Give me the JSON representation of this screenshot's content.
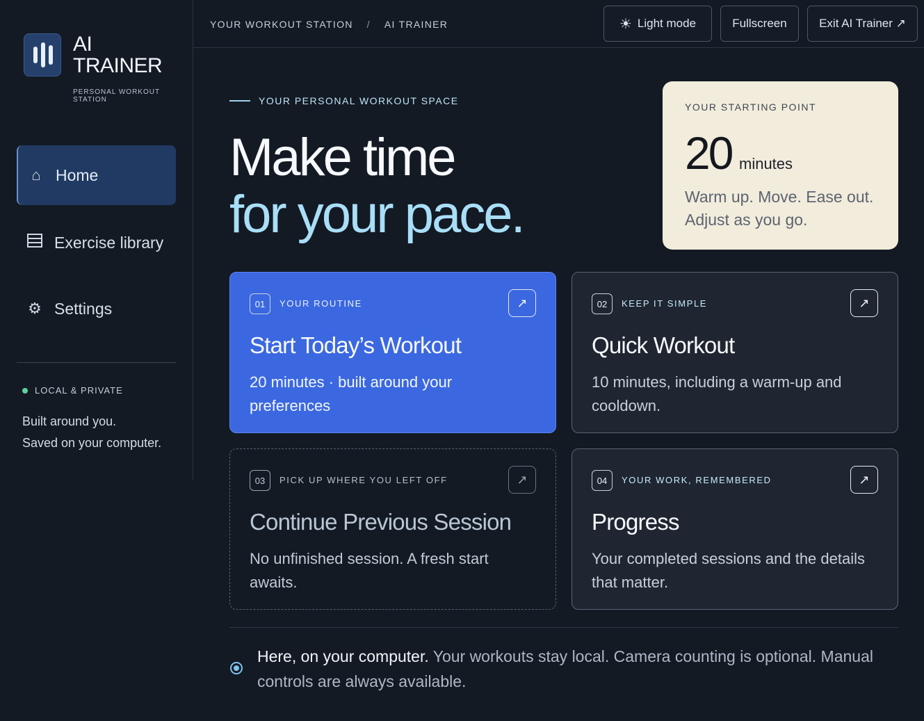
{
  "brand": {
    "title_line1": "AI",
    "title_line2": "TRAINER",
    "subtitle": "PERSONAL WORKOUT STATION"
  },
  "sidebar": {
    "items": [
      {
        "label": "Home",
        "icon": "home-icon",
        "active": true
      },
      {
        "label": "Exercise library",
        "icon": "list-icon",
        "active": false
      },
      {
        "label": "Settings",
        "icon": "gear-icon",
        "active": false
      }
    ],
    "privacy_badge": "LOCAL & PRIVATE",
    "privacy_line1": "Built around you.",
    "privacy_line2": "Saved on your computer."
  },
  "topbar": {
    "breadcrumb": [
      "YOUR WORKOUT STATION",
      "AI TRAINER"
    ],
    "breadcrumb_sep": "/",
    "light_mode_label": "Light mode",
    "fullscreen_label": "Fullscreen",
    "exit_label": "Exit AI Trainer ↗"
  },
  "hero": {
    "eyebrow": "YOUR PERSONAL WORKOUT SPACE",
    "line1": "Make time",
    "line2": "for your pace."
  },
  "starting_point": {
    "label": "YOUR STARTING POINT",
    "value": "20",
    "unit": "minutes",
    "description": "Warm up. Move. Ease out. Adjust as you go."
  },
  "cards": [
    {
      "num": "01",
      "kicker": "YOUR ROUTINE",
      "title": "Start Today’s Workout",
      "desc": "20 minutes · built around your preferences",
      "arrow": "↗"
    },
    {
      "num": "02",
      "kicker": "KEEP IT SIMPLE",
      "title": "Quick Workout",
      "desc": "10 minutes, including a warm-up and cooldown.",
      "arrow": "↗"
    },
    {
      "num": "03",
      "kicker": "PICK UP WHERE YOU LEFT OFF",
      "title": "Continue Previous Session",
      "desc": "No unfinished session. A fresh start awaits.",
      "arrow": "↗"
    },
    {
      "num": "04",
      "kicker": "YOUR WORK, REMEMBERED",
      "title": "Progress",
      "desc": "Your completed sessions and the details that matter.",
      "arrow": "↗"
    }
  ],
  "footer": {
    "strong": "Here, on your computer.",
    "rest": " Your workouts stay local. Camera counting is optional. Manual controls are always available."
  },
  "colors": {
    "background": "#131a24",
    "accent_blue": "#3b68e0",
    "hero_highlight": "#a9def7",
    "start_card": "#f2ecdc",
    "privacy_dot": "#5fd49a"
  }
}
